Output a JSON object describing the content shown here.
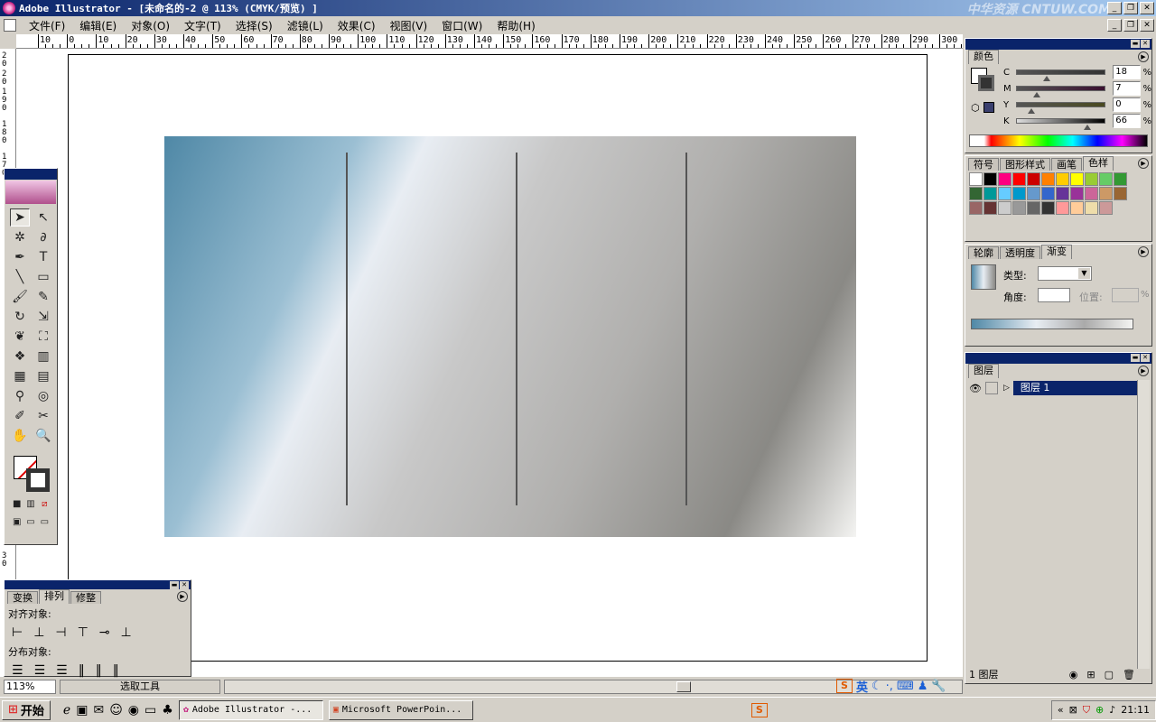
{
  "titlebar": {
    "title": "Adobe Illustrator - [未命名的-2 @ 113% (CMYK/预览) ]",
    "watermark": "中华资源 CNTUW.COM",
    "controls": {
      "minimize": "_",
      "restore": "❐",
      "close": "✕"
    }
  },
  "menubar": {
    "items": [
      "文件(F)",
      "编辑(E)",
      "对象(O)",
      "文字(T)",
      "选择(S)",
      "滤镜(L)",
      "效果(C)",
      "视图(V)",
      "窗口(W)",
      "帮助(H)"
    ]
  },
  "ruler": {
    "h_labels": [
      "10",
      "0",
      "10",
      "20",
      "30",
      "40",
      "50",
      "60",
      "70",
      "80",
      "90",
      "100",
      "110",
      "120",
      "130",
      "140",
      "150",
      "160",
      "170",
      "180",
      "190",
      "200",
      "210",
      "220",
      "230",
      "240",
      "250",
      "260",
      "270",
      "280",
      "290",
      "300"
    ],
    "v_labels": [
      "2\n0",
      "2\n0",
      "1\n9\n0",
      "1\n8\n0",
      "1\n7\n0",
      "3\n0"
    ]
  },
  "color_panel": {
    "tab": "颜色",
    "channels": [
      {
        "label": "C",
        "value": "18",
        "level": 0.18
      },
      {
        "label": "M",
        "value": "7",
        "level": 0.07
      },
      {
        "label": "Y",
        "value": "0",
        "level": 0.0
      },
      {
        "label": "K",
        "value": "66",
        "level": 0.66
      }
    ],
    "percent": "%"
  },
  "swatches_panel": {
    "tabs": [
      "符号",
      "图形样式",
      "画笔",
      "色样"
    ],
    "colors": [
      "#ffffff",
      "#000000",
      "#ff0080",
      "#ff0000",
      "#cc0000",
      "#ff8000",
      "#ffcc00",
      "#ffff00",
      "#99cc33",
      "#66cc66",
      "#339933",
      "#336633",
      "#009999",
      "#66ccff",
      "#0099cc",
      "#6699cc",
      "#3366cc",
      "#663399",
      "#993399",
      "#cc6699",
      "#cc9966",
      "#996633",
      "#996666",
      "#663333",
      "#cccccc",
      "#999999",
      "#666666",
      "#333333",
      "#ff9999",
      "#ffcc99",
      "#eeddaa",
      "#cc9999"
    ]
  },
  "gradient_panel": {
    "tabs": [
      "轮廓",
      "透明度",
      "渐变"
    ],
    "type_label": "类型:",
    "angle_label": "角度:",
    "position_label": "位置:",
    "percent": "%"
  },
  "layers_panel": {
    "tab": "图层",
    "layer_name": "图层 1",
    "footer_count": "1 图层"
  },
  "align_panel": {
    "tabs": [
      "变换",
      "排列",
      "修整"
    ],
    "align_label": "对齐对象:",
    "distribute_label": "分布对象:"
  },
  "statusbar": {
    "zoom": "113%",
    "tool": "选取工具"
  },
  "ime": {
    "mode": "英"
  },
  "taskbar": {
    "start": "开始",
    "tasks": [
      "Adobe Illustrator -...",
      "Microsoft PowerPoin..."
    ],
    "clock": "21:11"
  }
}
